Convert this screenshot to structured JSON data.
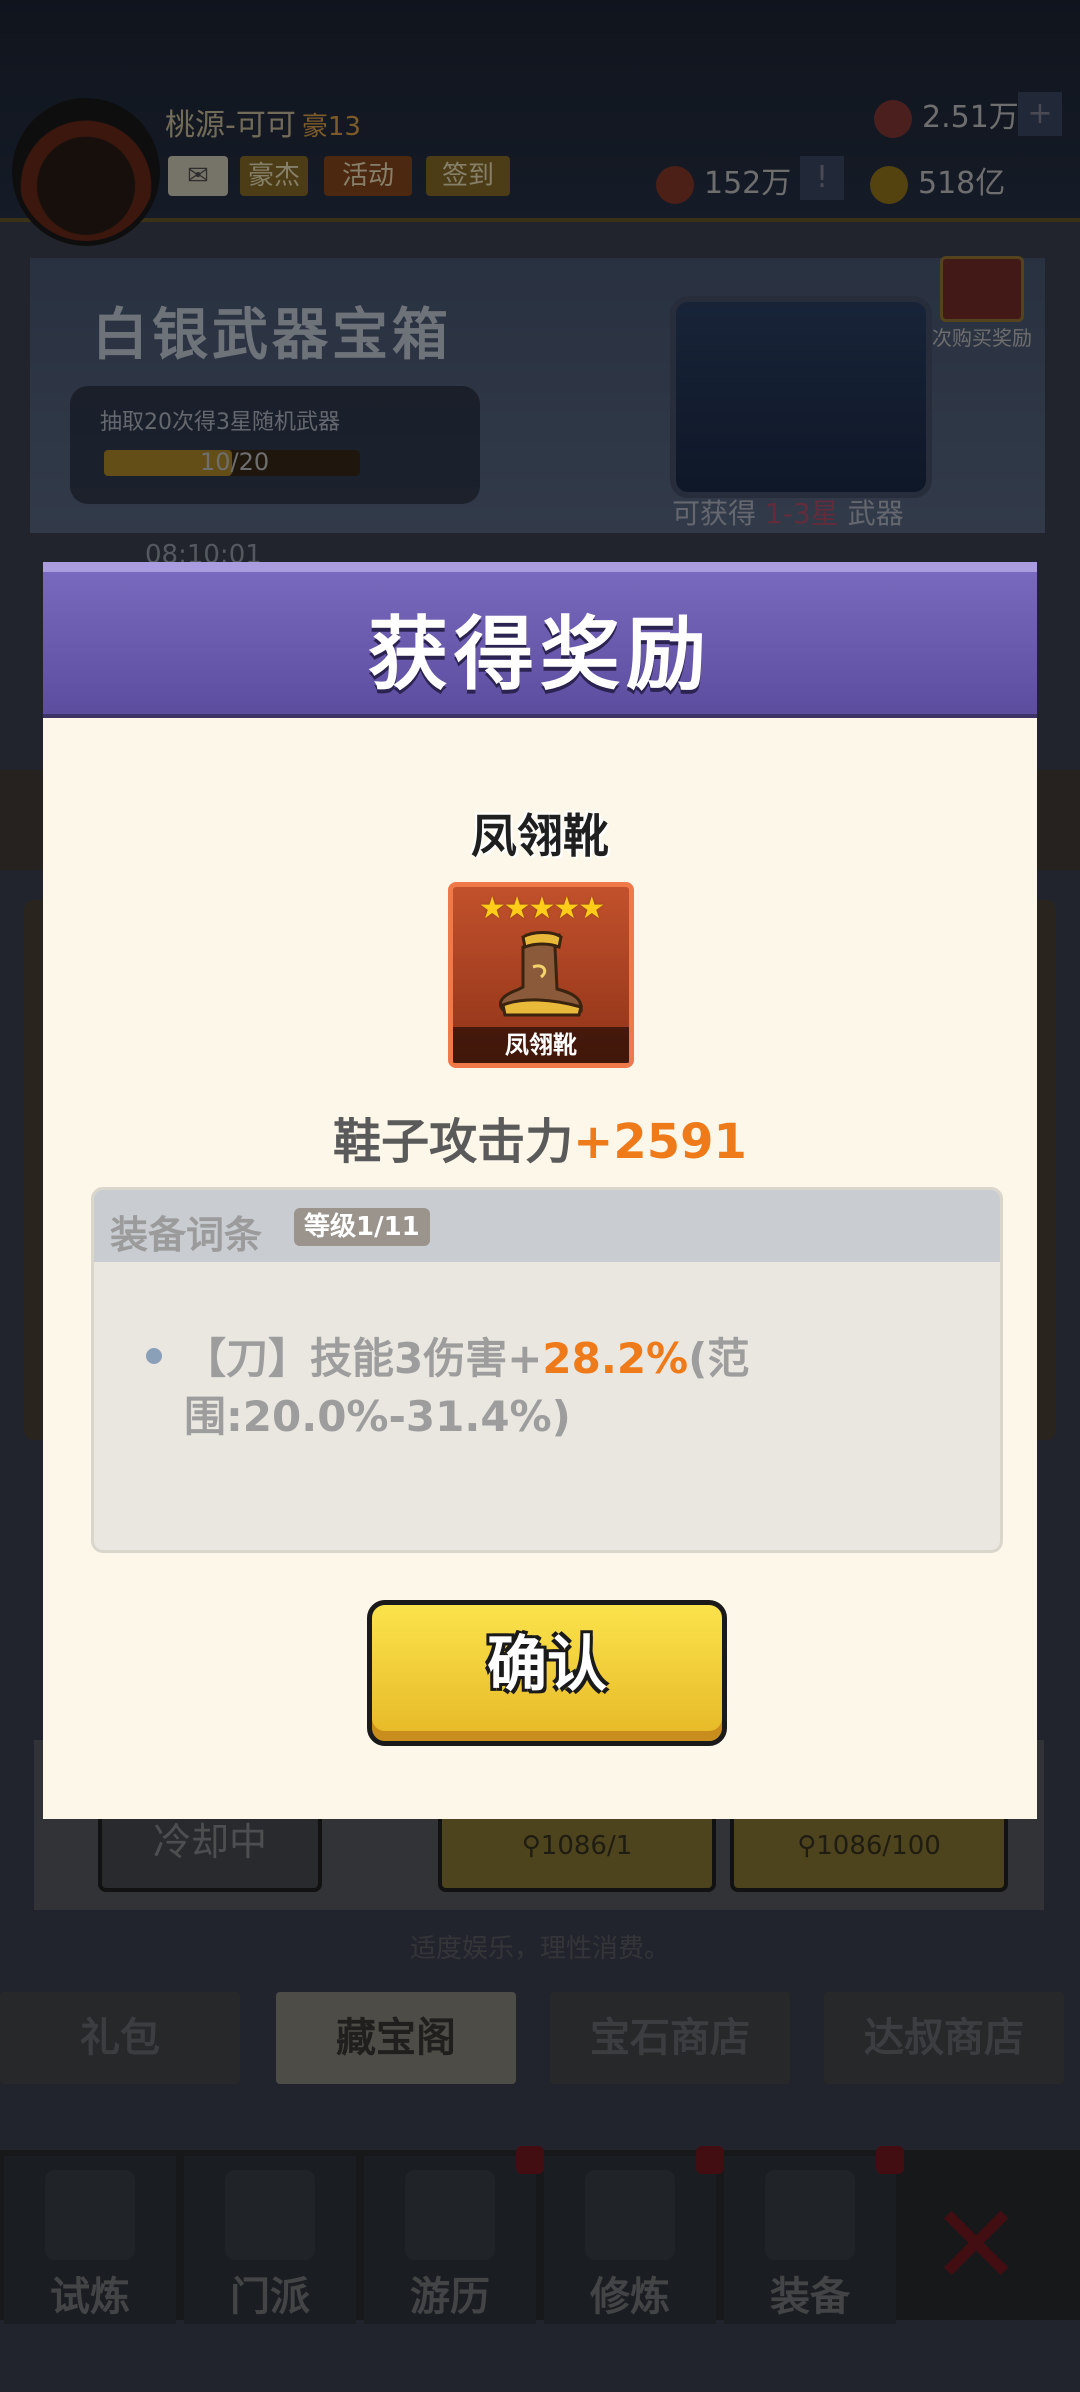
{
  "player": {
    "name": "桃源-可可",
    "level": "豪13"
  },
  "top_buttons": {
    "hero": "豪杰",
    "event": "活动",
    "signin": "签到"
  },
  "resources": {
    "gems": "2.51万",
    "tokens": "152万",
    "gold": "518亿"
  },
  "shop_banner": {
    "title": "白银武器宝箱",
    "progress_label": "抽取20次得3星随机武器",
    "progress_text": "10/20",
    "progress_fraction": 0.5,
    "chest_caption_prefix": "可获得",
    "chest_caption_highlight": "1-3星",
    "chest_caption_suffix": "武器",
    "first_buy_reward": "首次购买奖励",
    "timer": "08:10:01"
  },
  "lower_panel": {
    "cooldown": "冷却中",
    "key_single": "1086/1",
    "key_ten": "1086/100",
    "notice": "适度娱乐，理性消费。"
  },
  "shop_tabs": [
    "礼包",
    "藏宝阁",
    "宝石商店",
    "达叔商店"
  ],
  "bottom_nav": [
    "试炼",
    "门派",
    "游历",
    "修炼",
    "装备"
  ],
  "modal": {
    "title": "获得奖励",
    "item_name": "凤翎靴",
    "stars": "★★★★★",
    "stat_label": "鞋子攻击力",
    "stat_value": "+2591",
    "affix": {
      "title": "装备词条",
      "level": "等级1/11",
      "line_prefix": "【刀】技能3伤害+",
      "line_value": "28.2%",
      "line_suffix": "(范围:20.0%-31.4%)"
    },
    "confirm_label": "确认"
  },
  "colors": {
    "modal_header": "#6a5aae",
    "highlight": "#ef7a1a",
    "confirm": "#f3cf36"
  }
}
